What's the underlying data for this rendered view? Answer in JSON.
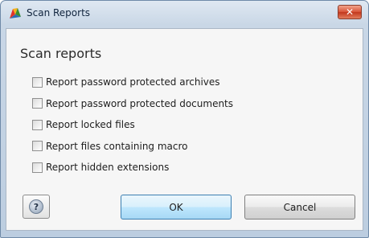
{
  "window": {
    "title": "Scan Reports",
    "app_icon": "avg-logo-icon",
    "close_icon": "close-icon"
  },
  "section": {
    "heading": "Scan reports"
  },
  "options": [
    {
      "label": "Report password protected archives",
      "checked": false
    },
    {
      "label": "Report password protected documents",
      "checked": false
    },
    {
      "label": "Report locked files",
      "checked": false
    },
    {
      "label": "Report files containing macro",
      "checked": false
    },
    {
      "label": "Report hidden extensions",
      "checked": false
    }
  ],
  "buttons": {
    "help_icon": "help-icon",
    "help_glyph": "?",
    "ok_label": "OK",
    "cancel_label": "Cancel"
  }
}
